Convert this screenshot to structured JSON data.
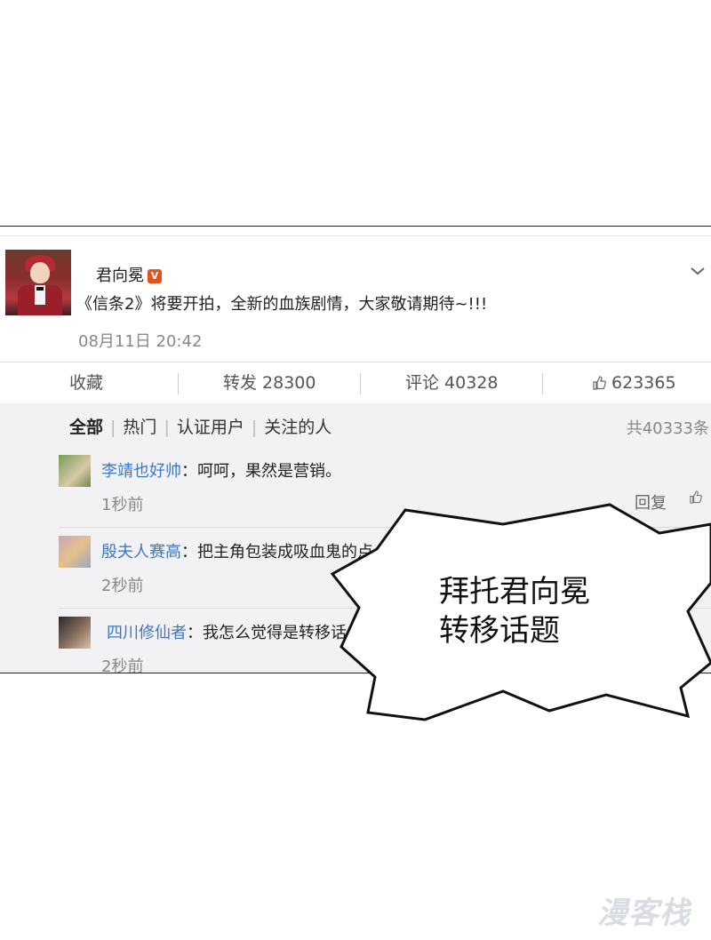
{
  "post": {
    "username": "君向冕",
    "verified_badge": "V",
    "text": "《信条2》将要开拍，全新的血族剧情，大家敬请期待~!!!",
    "time": "08月11日 20:42",
    "expand_icon": "chevron-down-icon"
  },
  "actions": {
    "favorite": "收藏",
    "repost": "转发 28300",
    "comment": "评论 40328",
    "likes": "623365",
    "like_icon": "thumbs-up-icon"
  },
  "comment_tabs": [
    "全部",
    "热门",
    "认证用户",
    "关注的人"
  ],
  "comment_total": "共40333条",
  "comments": [
    {
      "name": "李靖也好帅",
      "text": "：呵呵，果然是营销。",
      "time": "1秒前",
      "reply": "回复"
    },
    {
      "name": "殷夫人赛高",
      "text": "：把主角包装成吸血鬼的点",
      "time": "2秒前"
    },
    {
      "name": "四川修仙者",
      "text": "：我怎么觉得是转移话",
      "time": "2秒前"
    }
  ],
  "speech_bubble": {
    "line1": "拜托君向冕",
    "line2": "转移话题"
  },
  "watermark": "漫客栈",
  "colors": {
    "link_name": "#3b78c4",
    "badge": "#e2541a",
    "comments_bg": "#f2f2f5"
  }
}
